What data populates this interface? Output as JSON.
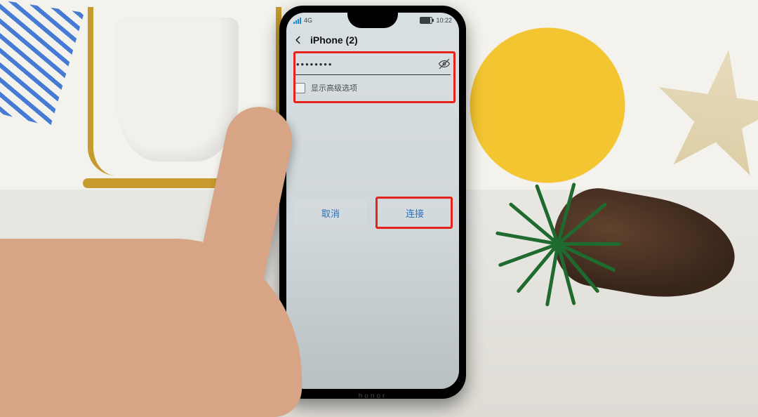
{
  "statusbar": {
    "network_label": "4G",
    "battery_icon": "battery-icon",
    "time": "10:22"
  },
  "header": {
    "back_icon": "back-icon",
    "title": "iPhone (2)"
  },
  "form": {
    "password_value": "••••••••",
    "visibility_icon": "eye-off-icon",
    "advanced_label": "显示高级选项"
  },
  "buttons": {
    "cancel": "取消",
    "connect": "连接"
  },
  "device": {
    "brand": "honor"
  }
}
